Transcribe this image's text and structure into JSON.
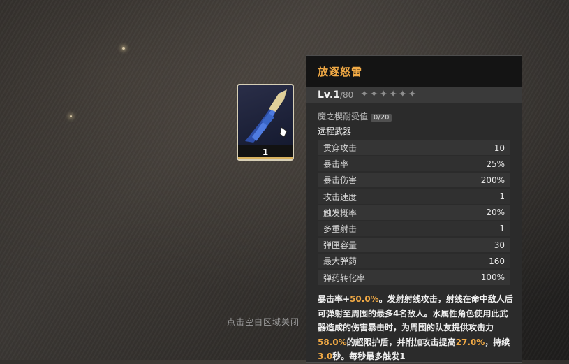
{
  "item": {
    "name": "放逐怒雷",
    "level": "Lv.1",
    "level_max": "/80",
    "stars": "✦✦✦✦✦✦",
    "durability_label": "魔之楔耐受值",
    "durability_value": "0/20",
    "category": "远程武器",
    "slot_quantity": "1"
  },
  "stats": [
    {
      "name": "贯穿攻击",
      "value": "10"
    },
    {
      "name": "暴击率",
      "value": "25%"
    },
    {
      "name": "暴击伤害",
      "value": "200%"
    },
    {
      "name": "攻击速度",
      "value": "1"
    },
    {
      "name": "触发概率",
      "value": "20%"
    },
    {
      "name": "多重射击",
      "value": "1"
    },
    {
      "name": "弹匣容量",
      "value": "30"
    },
    {
      "name": "最大弹药",
      "value": "160"
    },
    {
      "name": "弹药转化率",
      "value": "100%"
    }
  ],
  "description": [
    {
      "text": "暴击率+",
      "hl": false
    },
    {
      "text": "50.0%",
      "hl": true
    },
    {
      "text": "。发射射线攻击，射线在命中敌人后可弹射至周围的最多4名敌人。水属性角色使用此武器造成的伤害暴击时，为周围的队友提供攻击力",
      "hl": false
    },
    {
      "text": "58.0%",
      "hl": true
    },
    {
      "text": "的超限护盾，并附加攻击提高",
      "hl": false
    },
    {
      "text": "27.0%",
      "hl": true
    },
    {
      "text": "，持续",
      "hl": false
    },
    {
      "text": "3.0",
      "hl": true
    },
    {
      "text": "秒。每秒最多触发1",
      "hl": false
    }
  ],
  "close_hint": "点击空白区域关闭",
  "colors": {
    "accent": "#f0a945",
    "panel": "#2b2b2b",
    "slot_border": "#d7cfb6"
  }
}
